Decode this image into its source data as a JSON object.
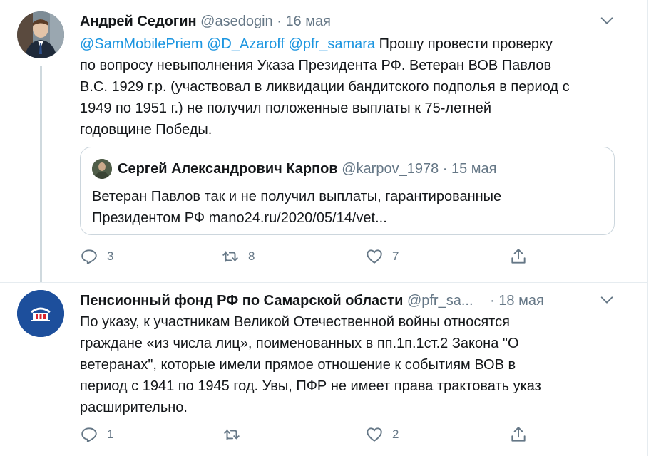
{
  "tweets": [
    {
      "author_name": "Андрей Седогин",
      "handle": "@asedogin",
      "dot": "·",
      "date": "16 мая",
      "mentions": "@SamMobilePriem @D_Azaroff @pfr_samara",
      "text_lines": [
        "Прошу провести проверку",
        "по вопросу невыполнения Указа Президента РФ. Ветеран ВОВ Павлов",
        "В.С. 1929 г.р. (участвовал в ликвидации бандитского подполья в период с",
        "1949 по 1951 г.) не получил положенные выплаты к 75-летней",
        "годовщине Победы."
      ],
      "quote": {
        "author_name": "Сергей Александрович Карпов",
        "handle": "@karpov_1978",
        "dot": "·",
        "date": "15 мая",
        "text_lines": [
          "Ветеран Павлов так и не получил выплаты, гарантированные",
          "Президентом РФ mano24.ru/2020/05/14/vet..."
        ]
      },
      "actions": {
        "replies": "3",
        "retweets": "8",
        "likes": "7"
      }
    },
    {
      "author_name": "Пенсионный фонд РФ по Самарской области",
      "handle": "@pfr_sa...",
      "dot": "·",
      "date": "18 мая",
      "text_lines": [
        "По указу, к участникам Великой Отечественной войны относятся",
        "граждане «из числа лиц», поименованных в пп.1п.1ст.2 Закона \"О",
        "ветеранах\", которые имели прямое отношение к событиям ВОВ в",
        "период с 1941 по 1945 год. Увы, ПФР не имеет права трактовать указ",
        "расширительно."
      ],
      "actions": {
        "replies": "1",
        "retweets": "",
        "likes": "2"
      }
    }
  ],
  "colors": {
    "mention": "#1b95e0",
    "muted": "#657786",
    "border": "#ccd6dd",
    "pfr_avatar_bg": "#1d4f9c"
  }
}
